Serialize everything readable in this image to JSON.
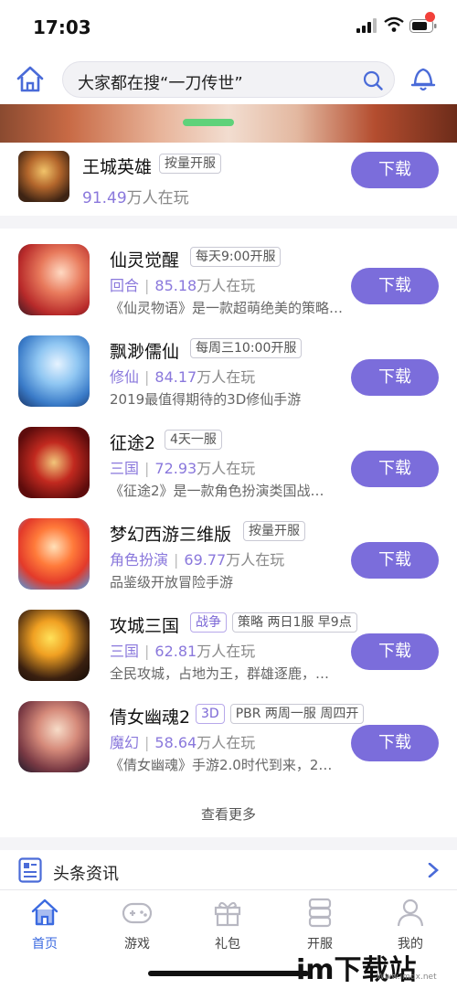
{
  "status_bar": {
    "time": "17:03"
  },
  "header": {
    "search_placeholder": "大家都在搜“一刀传世”"
  },
  "featured": {
    "name": "王城英雄",
    "tag": "按量开服",
    "players_count": "91.49",
    "players_unit": "万人在玩",
    "download": "下载"
  },
  "games": [
    {
      "name": "仙灵觉醒",
      "tags": [
        "每天9:00开服"
      ],
      "genre": "回合",
      "count": "85.18",
      "unit": "万人在玩",
      "desc": "《仙灵物语》是一款超萌绝美的策略…",
      "download": "下载"
    },
    {
      "name": "飘渺儒仙",
      "tags": [
        "每周三10:00开服"
      ],
      "genre": "修仙",
      "count": "84.17",
      "unit": "万人在玩",
      "desc": "2019最值得期待的3D修仙手游",
      "download": "下载"
    },
    {
      "name": "征途2",
      "tags": [
        "4天一服"
      ],
      "genre": "三国",
      "count": "72.93",
      "unit": "万人在玩",
      "desc": "《征途2》是一款角色扮演类国战…",
      "download": "下载"
    },
    {
      "name": "梦幻西游三维版",
      "tags": [
        "按量开服"
      ],
      "genre": "角色扮演",
      "count": "69.77",
      "unit": "万人在玩",
      "desc": "品鉴级开放冒险手游",
      "download": "下载"
    },
    {
      "name": "攻城三国",
      "tags": [
        "战争",
        "策略 两日1服 早9点"
      ],
      "genre": "三国",
      "count": "62.81",
      "unit": "万人在玩",
      "desc": "全民攻城，占地为王，群雄逐鹿，…",
      "download": "下载"
    },
    {
      "name": "倩女幽魂2",
      "tags": [
        "3D",
        "PBR 两周一服 周四开"
      ],
      "genre": "魔幻",
      "count": "58.64",
      "unit": "万人在玩",
      "desc": "《倩女幽魂》手游2.0时代到来，2…",
      "download": "下载"
    }
  ],
  "see_more": "查看更多",
  "news": {
    "title": "头条资讯"
  },
  "tabs": [
    {
      "label": "首页",
      "icon": "home-icon",
      "active": true
    },
    {
      "label": "游戏",
      "icon": "gamepad-icon",
      "active": false
    },
    {
      "label": "礼包",
      "icon": "gift-icon",
      "active": false
    },
    {
      "label": "开服",
      "icon": "server-icon",
      "active": false
    },
    {
      "label": "我的",
      "icon": "user-icon",
      "active": false
    }
  ],
  "watermark": {
    "main": "im下载站",
    "sub": "Www.imdx.net"
  },
  "colors": {
    "accent": "#7b6ddb",
    "active_tab": "#3b6ae0",
    "badge": "#f2413a"
  }
}
